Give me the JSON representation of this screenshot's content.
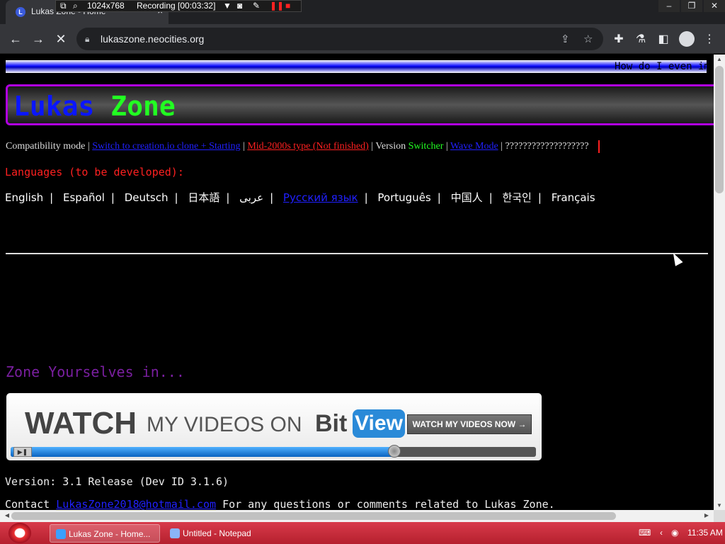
{
  "browser": {
    "tab_title": "Lukas Zone - Home",
    "tab_favicon": "L",
    "tab_close": "×",
    "url": "lukaszone.neocities.org",
    "recorder": {
      "resolution": "1024x768",
      "status": "Recording [00:03:32]"
    },
    "window_controls": [
      "–",
      "❐",
      "✕"
    ]
  },
  "page": {
    "marquee": "How do I even im",
    "logo_part1": "Lukas",
    "logo_part2": "Zone",
    "compat": {
      "label": "Compatibility mode",
      "links": [
        {
          "text": "Switch to creation.io clone + Starting",
          "color": "#2020ff"
        },
        {
          "text": "Mid-2000s type (Not finished)",
          "color": "#ff2020"
        }
      ],
      "version_switcher_a": "Version",
      "version_switcher_b": "Switcher",
      "links2": [
        {
          "text": "Wave Mode",
          "color": "#2020ff"
        }
      ],
      "question_marks": "???????????????????"
    },
    "languages_heading": "Languages (to be developed):",
    "languages": [
      "English",
      "Español",
      "Deutsch",
      "日本語",
      "عربى",
      "Русский язык",
      "Português",
      "中国人",
      "한국인",
      "Français"
    ],
    "zone_title": "Zone Yourselves in...",
    "bitview_banner": {
      "watch": "WATCH",
      "middle": "MY VIDEOS ON",
      "bit": "Bit",
      "view": "View",
      "button": "WATCH MY VIDEOS NOW →",
      "progress": 0.73
    },
    "version": "Version: 3.1 Release (Dev ID 3.1.6)",
    "contact_prefix": "Contact",
    "contact_email": "LukasZone2018@hotmail.com",
    "contact_suffix": "For any questions or comments related to Lukas Zone."
  },
  "taskbar": {
    "tasks": [
      {
        "label": "Lukas Zone - Home...",
        "icon_color": "#3aa0ff"
      },
      {
        "label": "Untitled - Notepad",
        "icon_color": "#8ab4f8"
      }
    ],
    "clock": "11:35 AM"
  },
  "colors": {
    "accent_purple": "#b000e0",
    "link_blue": "#2020ff",
    "link_red": "#ff2020",
    "taskbar_red": "#c8283a"
  }
}
